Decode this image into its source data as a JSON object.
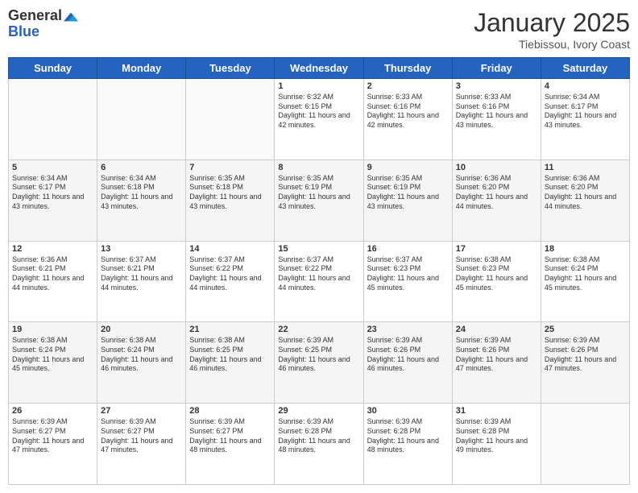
{
  "logo": {
    "general": "General",
    "blue": "Blue"
  },
  "title": "January 2025",
  "location": "Tiebissou, Ivory Coast",
  "days_header": [
    "Sunday",
    "Monday",
    "Tuesday",
    "Wednesday",
    "Thursday",
    "Friday",
    "Saturday"
  ],
  "weeks": [
    [
      {
        "day": "",
        "info": ""
      },
      {
        "day": "",
        "info": ""
      },
      {
        "day": "",
        "info": ""
      },
      {
        "day": "1",
        "info": "Sunrise: 6:32 AM\nSunset: 6:15 PM\nDaylight: 11 hours and 42 minutes."
      },
      {
        "day": "2",
        "info": "Sunrise: 6:33 AM\nSunset: 6:16 PM\nDaylight: 11 hours and 42 minutes."
      },
      {
        "day": "3",
        "info": "Sunrise: 6:33 AM\nSunset: 6:16 PM\nDaylight: 11 hours and 43 minutes."
      },
      {
        "day": "4",
        "info": "Sunrise: 6:34 AM\nSunset: 6:17 PM\nDaylight: 11 hours and 43 minutes."
      }
    ],
    [
      {
        "day": "5",
        "info": "Sunrise: 6:34 AM\nSunset: 6:17 PM\nDaylight: 11 hours and 43 minutes."
      },
      {
        "day": "6",
        "info": "Sunrise: 6:34 AM\nSunset: 6:18 PM\nDaylight: 11 hours and 43 minutes."
      },
      {
        "day": "7",
        "info": "Sunrise: 6:35 AM\nSunset: 6:18 PM\nDaylight: 11 hours and 43 minutes."
      },
      {
        "day": "8",
        "info": "Sunrise: 6:35 AM\nSunset: 6:19 PM\nDaylight: 11 hours and 43 minutes."
      },
      {
        "day": "9",
        "info": "Sunrise: 6:35 AM\nSunset: 6:19 PM\nDaylight: 11 hours and 43 minutes."
      },
      {
        "day": "10",
        "info": "Sunrise: 6:36 AM\nSunset: 6:20 PM\nDaylight: 11 hours and 44 minutes."
      },
      {
        "day": "11",
        "info": "Sunrise: 6:36 AM\nSunset: 6:20 PM\nDaylight: 11 hours and 44 minutes."
      }
    ],
    [
      {
        "day": "12",
        "info": "Sunrise: 6:36 AM\nSunset: 6:21 PM\nDaylight: 11 hours and 44 minutes."
      },
      {
        "day": "13",
        "info": "Sunrise: 6:37 AM\nSunset: 6:21 PM\nDaylight: 11 hours and 44 minutes."
      },
      {
        "day": "14",
        "info": "Sunrise: 6:37 AM\nSunset: 6:22 PM\nDaylight: 11 hours and 44 minutes."
      },
      {
        "day": "15",
        "info": "Sunrise: 6:37 AM\nSunset: 6:22 PM\nDaylight: 11 hours and 44 minutes."
      },
      {
        "day": "16",
        "info": "Sunrise: 6:37 AM\nSunset: 6:23 PM\nDaylight: 11 hours and 45 minutes."
      },
      {
        "day": "17",
        "info": "Sunrise: 6:38 AM\nSunset: 6:23 PM\nDaylight: 11 hours and 45 minutes."
      },
      {
        "day": "18",
        "info": "Sunrise: 6:38 AM\nSunset: 6:24 PM\nDaylight: 11 hours and 45 minutes."
      }
    ],
    [
      {
        "day": "19",
        "info": "Sunrise: 6:38 AM\nSunset: 6:24 PM\nDaylight: 11 hours and 45 minutes."
      },
      {
        "day": "20",
        "info": "Sunrise: 6:38 AM\nSunset: 6:24 PM\nDaylight: 11 hours and 46 minutes."
      },
      {
        "day": "21",
        "info": "Sunrise: 6:38 AM\nSunset: 6:25 PM\nDaylight: 11 hours and 46 minutes."
      },
      {
        "day": "22",
        "info": "Sunrise: 6:39 AM\nSunset: 6:25 PM\nDaylight: 11 hours and 46 minutes."
      },
      {
        "day": "23",
        "info": "Sunrise: 6:39 AM\nSunset: 6:26 PM\nDaylight: 11 hours and 46 minutes."
      },
      {
        "day": "24",
        "info": "Sunrise: 6:39 AM\nSunset: 6:26 PM\nDaylight: 11 hours and 47 minutes."
      },
      {
        "day": "25",
        "info": "Sunrise: 6:39 AM\nSunset: 6:26 PM\nDaylight: 11 hours and 47 minutes."
      }
    ],
    [
      {
        "day": "26",
        "info": "Sunrise: 6:39 AM\nSunset: 6:27 PM\nDaylight: 11 hours and 47 minutes."
      },
      {
        "day": "27",
        "info": "Sunrise: 6:39 AM\nSunset: 6:27 PM\nDaylight: 11 hours and 47 minutes."
      },
      {
        "day": "28",
        "info": "Sunrise: 6:39 AM\nSunset: 6:27 PM\nDaylight: 11 hours and 48 minutes."
      },
      {
        "day": "29",
        "info": "Sunrise: 6:39 AM\nSunset: 6:28 PM\nDaylight: 11 hours and 48 minutes."
      },
      {
        "day": "30",
        "info": "Sunrise: 6:39 AM\nSunset: 6:28 PM\nDaylight: 11 hours and 48 minutes."
      },
      {
        "day": "31",
        "info": "Sunrise: 6:39 AM\nSunset: 6:28 PM\nDaylight: 11 hours and 49 minutes."
      },
      {
        "day": "",
        "info": ""
      }
    ]
  ],
  "colors": {
    "header_bg": "#2563c0",
    "header_text": "#ffffff",
    "border": "#cccccc",
    "alt_row": "#f5f5f5"
  }
}
